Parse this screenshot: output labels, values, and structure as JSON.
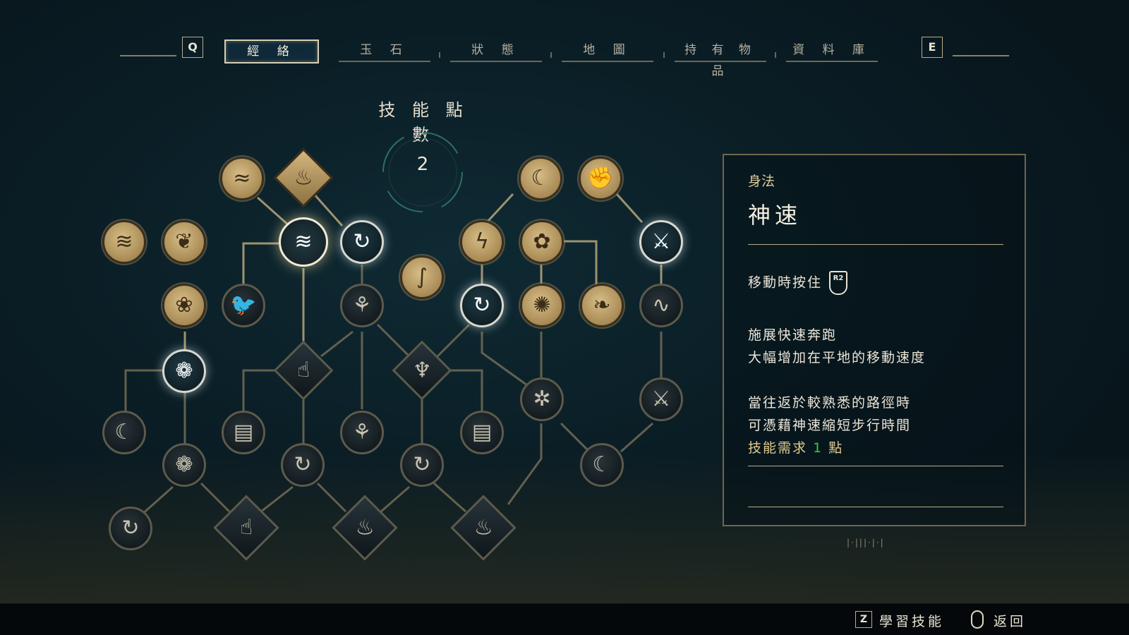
{
  "tabs": {
    "prev_key": "Q",
    "next_key": "E",
    "items": [
      "經 絡",
      "玉 石",
      "狀 態",
      "地 圖",
      "持 有 物 品",
      "資 料 庫"
    ],
    "active_index": 0
  },
  "skill_points": {
    "title": "技 能 點 數",
    "value": "2"
  },
  "tree": {
    "nodes": [
      {
        "id": "n1",
        "state": "gold",
        "icon": "swift-wind-icon",
        "glyph": "≋"
      },
      {
        "id": "n2",
        "state": "gold",
        "icon": "fox-leap-icon",
        "glyph": "❦"
      },
      {
        "id": "n3",
        "state": "gold",
        "icon": "wind-fox-icon",
        "glyph": "≈"
      },
      {
        "id": "n4",
        "state": "gold",
        "icon": "flame-shard-icon",
        "glyph": "♨"
      },
      {
        "id": "n5",
        "state": "selected",
        "icon": "dash-sprint-icon",
        "glyph": "≋"
      },
      {
        "id": "n6",
        "state": "light",
        "icon": "rotate-upgrade-icon",
        "glyph": "↻"
      },
      {
        "id": "n7",
        "state": "gold",
        "icon": "spiral-staff-icon",
        "glyph": "∫"
      },
      {
        "id": "n8",
        "state": "gold",
        "icon": "crescent-moon-icon",
        "glyph": "☾"
      },
      {
        "id": "n9",
        "state": "gold",
        "icon": "beast-claw-icon",
        "glyph": "✊"
      },
      {
        "id": "n10",
        "state": "gold",
        "icon": "lightning-fox-icon",
        "glyph": "ϟ"
      },
      {
        "id": "n11",
        "state": "gold",
        "icon": "flower-burst-icon",
        "glyph": "✿"
      },
      {
        "id": "n12",
        "state": "light",
        "icon": "spear-strike-icon",
        "glyph": "⚔"
      },
      {
        "id": "n13",
        "state": "gold",
        "icon": "petal-dance-icon",
        "glyph": "❀"
      },
      {
        "id": "n14",
        "state": "dark",
        "icon": "crow-icon",
        "glyph": "🐦"
      },
      {
        "id": "n15",
        "state": "dark",
        "icon": "lotus-icon",
        "glyph": "⚘"
      },
      {
        "id": "n16",
        "state": "light",
        "icon": "rotate-upgrade-icon",
        "glyph": "↻"
      },
      {
        "id": "n17",
        "state": "gold",
        "icon": "sunburst-icon",
        "glyph": "✺"
      },
      {
        "id": "n18",
        "state": "gold",
        "icon": "spirit-fox-icon",
        "glyph": "❧"
      },
      {
        "id": "n19",
        "state": "dark",
        "icon": "wave-fist-icon",
        "glyph": "∿"
      },
      {
        "id": "n20",
        "state": "light",
        "icon": "blossom-spirit-icon",
        "glyph": "❁"
      },
      {
        "id": "n21",
        "state": "dark",
        "icon": "crescent-upgrade-icon",
        "glyph": "☾"
      },
      {
        "id": "n22",
        "state": "dark",
        "icon": "talisman-icon",
        "glyph": "▤"
      },
      {
        "id": "n23",
        "state": "dark",
        "icon": "lotus-icon",
        "glyph": "⚘"
      },
      {
        "id": "n24",
        "state": "dark",
        "icon": "talisman-icon",
        "glyph": "▤"
      },
      {
        "id": "n25",
        "state": "dark",
        "icon": "vortex-flower-icon",
        "glyph": "✲"
      },
      {
        "id": "n26",
        "state": "dark",
        "icon": "spear-strike-icon",
        "glyph": "⚔"
      },
      {
        "id": "n27",
        "state": "dark",
        "icon": "blossom-spirit-icon",
        "glyph": "❁"
      },
      {
        "id": "n28",
        "state": "dark",
        "icon": "rotate-upgrade-icon",
        "glyph": "↻"
      },
      {
        "id": "n29",
        "state": "dark",
        "icon": "rotate-upgrade-icon",
        "glyph": "↻"
      },
      {
        "id": "n30",
        "state": "dark",
        "icon": "crescent-upgrade-icon",
        "glyph": "☾"
      },
      {
        "id": "n31",
        "state": "dark",
        "icon": "rotate-upgrade-icon",
        "glyph": "↻"
      }
    ],
    "diamonds": [
      {
        "id": "d1",
        "state": "dark",
        "icon": "hand-seal-icon",
        "glyph": "☝"
      },
      {
        "id": "d2",
        "state": "dark",
        "icon": "demon-mask-icon",
        "glyph": "♆"
      },
      {
        "id": "d3",
        "state": "dark",
        "icon": "mushroom-hand-icon",
        "glyph": "☝"
      },
      {
        "id": "d4",
        "state": "dark",
        "icon": "flame-palm-icon",
        "glyph": "♨"
      },
      {
        "id": "d5",
        "state": "dark",
        "icon": "blaze-icon",
        "glyph": "♨"
      }
    ]
  },
  "detail": {
    "category": "身法",
    "name": "神速",
    "control_text": "移動時按住",
    "control_button": "R2",
    "desc_line1": "施展快速奔跑",
    "desc_line2": "大幅增加在平地的移動速度",
    "desc_line3": "當往返於較熟悉的路徑時",
    "desc_line4": "可憑藉神速縮短步行時間",
    "req_prefix": "技能需求",
    "req_value": "1",
    "req_suffix": "點"
  },
  "prompts": {
    "learn_key": "Z",
    "learn_label": "學習技能",
    "back_label": "返回"
  }
}
